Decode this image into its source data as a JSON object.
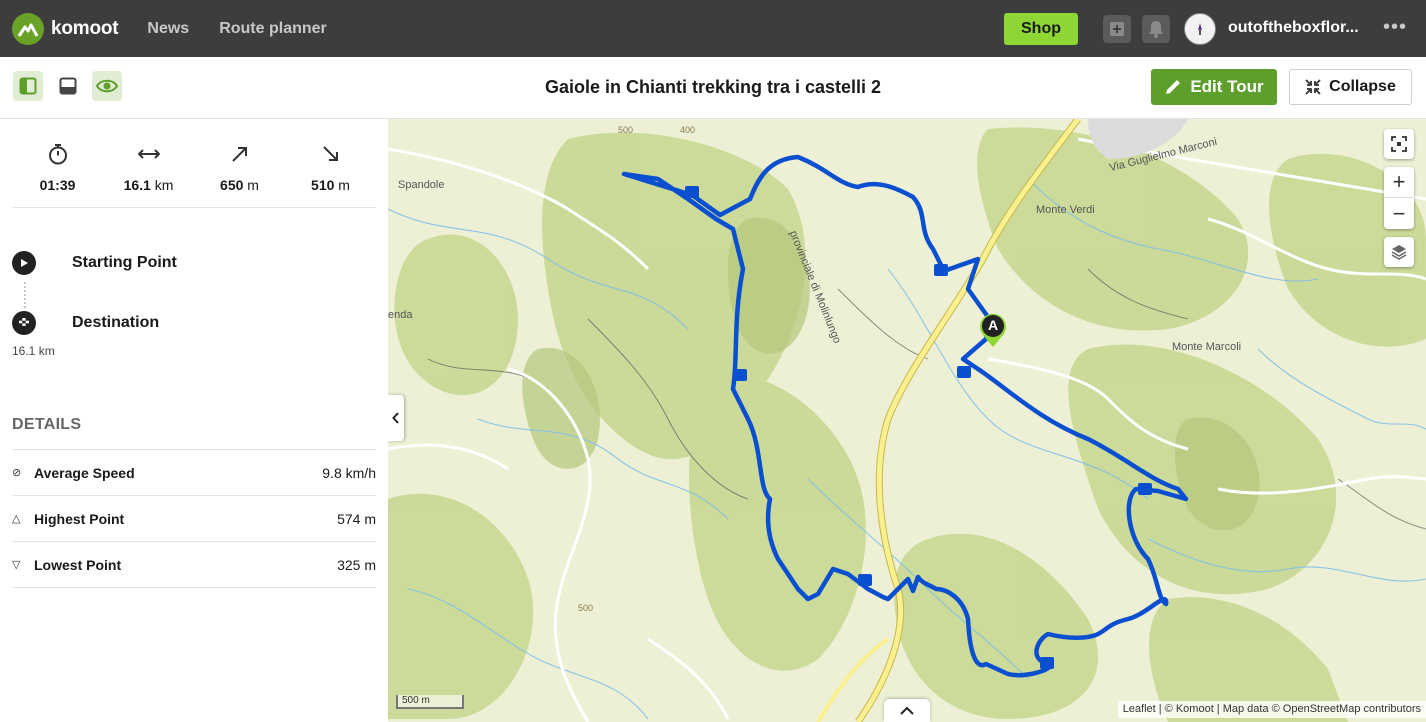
{
  "nav": {
    "brand": "komoot",
    "links": [
      "News",
      "Route planner"
    ],
    "shop_label": "Shop",
    "username": "outoftheboxflor...",
    "more": "•••"
  },
  "toolbar": {
    "title": "Gaiole in Chianti trekking tra i castelli 2",
    "edit_label": "Edit Tour",
    "collapse_label": "Collapse"
  },
  "stats": [
    {
      "icon": "stopwatch-icon",
      "value": "01:39",
      "unit": ""
    },
    {
      "icon": "distance-arrows-icon",
      "value": "16.1",
      "unit": "km"
    },
    {
      "icon": "uphill-arrow-icon",
      "value": "650",
      "unit": "m"
    },
    {
      "icon": "downhill-arrow-icon",
      "value": "510",
      "unit": "m"
    }
  ],
  "waypoints": {
    "start_label": "Starting Point",
    "end_label": "Destination",
    "end_distance": "16.1 km"
  },
  "details": {
    "title": "DETAILS",
    "rows": [
      {
        "icon": "⊘",
        "label": "Average Speed",
        "value": "9.8 km/h"
      },
      {
        "icon": "△",
        "label": "Highest Point",
        "value": "574 m"
      },
      {
        "icon": "▽",
        "label": "Lowest Point",
        "value": "325 m"
      }
    ]
  },
  "map": {
    "labels": {
      "via": "Via Guglielmo Marconi",
      "monte_verdi": "Monte Verdi",
      "monte_marcoli": "Monte Marcoli",
      "spandole": "Spandole",
      "provinciale": "provinciale di Molinlungo",
      "enda": "enda",
      "c500a": "500",
      "c400": "400",
      "c500b": "500"
    },
    "marker_letter": "A",
    "scale": "500 m",
    "attribution": "Leaflet | © Komoot | Map data © OpenStreetMap contributors",
    "route_color": "#0a4fd0",
    "land_color": "#eef0d6",
    "forest_color": "#c9d99a"
  }
}
